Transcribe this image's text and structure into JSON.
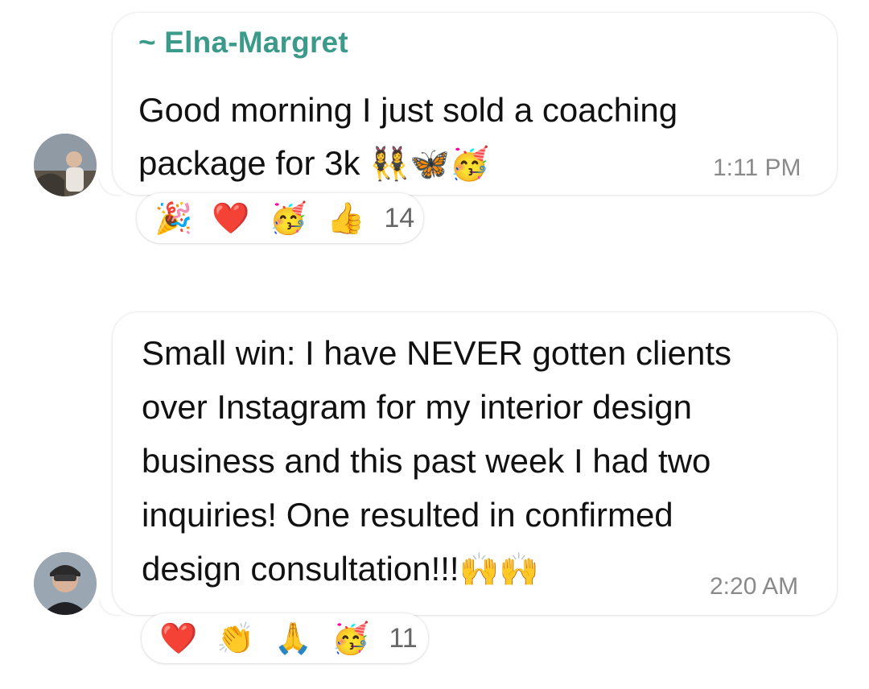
{
  "messages": [
    {
      "sender": "~ Elna-Margret",
      "lines": [
        "Good morning I just sold a coaching",
        "package for 3k"
      ],
      "inline_emojis": [
        "👯‍♀️",
        "🦋",
        "🥳"
      ],
      "time": "1:11 PM",
      "reactions": {
        "emojis": [
          "🎉",
          "❤️",
          "🥳",
          "👍"
        ],
        "count": "14"
      }
    },
    {
      "lines": [
        "Small win: I have NEVER gotten clients",
        "over Instagram for my interior design",
        "business and this past week I had two",
        "inquiries! One resulted in confirmed",
        "design consultation!!!"
      ],
      "inline_emojis": [
        "🙌",
        "🙌"
      ],
      "time": "2:20 AM",
      "reactions": {
        "emojis": [
          "❤️",
          "👏",
          "🙏",
          "🥳"
        ],
        "count": "11"
      }
    }
  ],
  "colors": {
    "sender": "#3b9a8a",
    "time": "#8a8a8a",
    "text": "#111111"
  },
  "icons": [
    "avatar-photo-elna-margret",
    "avatar-photo-second-sender"
  ]
}
